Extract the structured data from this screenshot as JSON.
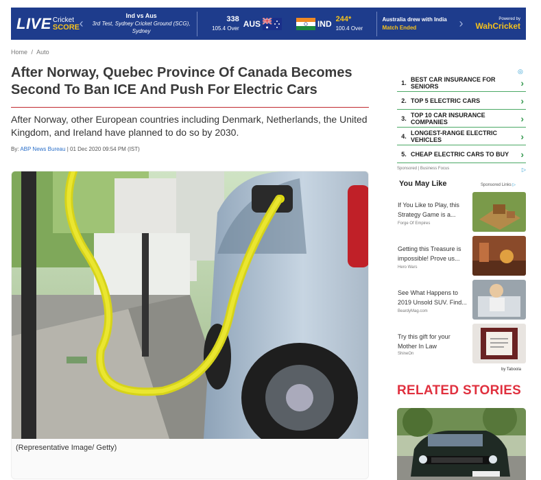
{
  "banner": {
    "live": "LIVE",
    "cricket": "Cricket",
    "score": "SCORE",
    "match_title": "Ind vs Aus",
    "match_sub": "3rd Test, Sydney Cricket Ground (SCG), Sydney",
    "team1_runs": "338",
    "team1_overs": "105.4 Over",
    "team1": "AUS",
    "team2": "IND",
    "team2_runs": "244*",
    "team2_overs": "100.4 Over",
    "status": "Australia drew with India",
    "status2": "Match Ended",
    "powered_by": "Powered by",
    "powered_brand": "WahCricket"
  },
  "breadcrumb": {
    "home": "Home",
    "sep": "/",
    "section": "Auto"
  },
  "article": {
    "title": "After Norway, Quebec Province Of Canada Becomes Second To Ban ICE And Push For Electric Cars",
    "summary": "After Norway, other European countries including Denmark, Netherlands, the United Kingdom, and Ireland have planned to do so by 2030.",
    "by_label": "By:",
    "author": "ABP News Bureau",
    "date": "| 01 Dec 2020 09:54 PM (IST)",
    "caption": "(Representative Image/ Getty)"
  },
  "sidebar": {
    "list": [
      {
        "n": "1.",
        "t": "BEST CAR INSURANCE FOR SENIORS"
      },
      {
        "n": "2.",
        "t": "TOP 5 ELECTRIC CARS"
      },
      {
        "n": "3.",
        "t": "TOP 10 CAR INSURANCE COMPANIES"
      },
      {
        "n": "4.",
        "t": "LONGEST-RANGE ELECTRIC VEHICLES"
      },
      {
        "n": "5.",
        "t": "CHEAP ELECTRIC CARS TO BUY"
      }
    ],
    "sponsored": "Sponsored | Business Focus",
    "you_may_like": "You May Like",
    "sponsored_links": "Sponsored Links",
    "cards": [
      {
        "text": "If You Like to Play, this Strategy Game is a...",
        "src": "Forge Of Empires"
      },
      {
        "text": "Getting this Treasure is impossible! Prove us...",
        "src": "Hero Wars"
      },
      {
        "text": "See What Happens to 2019 Unsold SUV. Find...",
        "src": "BeardyMag.com"
      },
      {
        "text": "Try this gift for your Mother In Law",
        "src": "ShineOn"
      }
    ],
    "by_taboola": "by Taboola",
    "related": "RELATED STORIES"
  },
  "colors": {
    "banner": "#1e3c8c",
    "accent": "#e0303e",
    "link": "#2a6fc9",
    "list_green": "#3a9b54"
  }
}
